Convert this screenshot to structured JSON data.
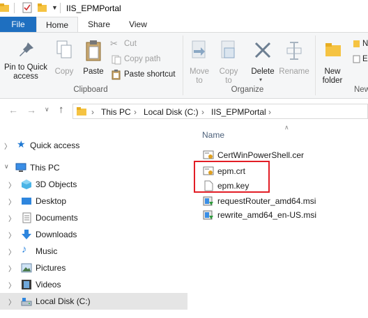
{
  "window": {
    "title": "IIS_EPMPortal"
  },
  "tabs": {
    "file": "File",
    "home": "Home",
    "share": "Share",
    "view": "View"
  },
  "ribbon": {
    "pin_to_quick_access": "Pin to Quick access",
    "pin_line1": "Pin to Quick",
    "pin_line2": "access",
    "copy": "Copy",
    "paste": "Paste",
    "cut": "Cut",
    "copy_path": "Copy path",
    "paste_shortcut": "Paste shortcut",
    "clipboard_group": "Clipboard",
    "move_to_line1": "Move",
    "move_to_line2": "to",
    "copy_to_line1": "Copy",
    "copy_to_line2": "to",
    "delete": "Delete",
    "rename": "Rename",
    "organize_group": "Organize",
    "new_folder_line1": "New",
    "new_folder_line2": "folder",
    "new_group_partial": "New",
    "new_item_partial": "N",
    "easy_access_partial": "Ea"
  },
  "address": {
    "crumbs": [
      "This PC",
      "Local Disk (C:)",
      "IIS_EPMPortal"
    ]
  },
  "nav": {
    "quick_access": "Quick access",
    "this_pc": "This PC",
    "objects3d": "3D Objects",
    "desktop": "Desktop",
    "documents": "Documents",
    "downloads": "Downloads",
    "music": "Music",
    "pictures": "Pictures",
    "videos": "Videos",
    "local_disk": "Local Disk (C:)"
  },
  "file_list": {
    "column_name": "Name",
    "files": [
      "CertWinPowerShell.cer",
      "epm.crt",
      "epm.key",
      "requestRouter_amd64.msi",
      "rewrite_amd64_en-US.msi"
    ]
  },
  "colors": {
    "accent": "#1e6fc0",
    "highlight": "#e21d25",
    "selected_bg": "#e5e5e5"
  }
}
